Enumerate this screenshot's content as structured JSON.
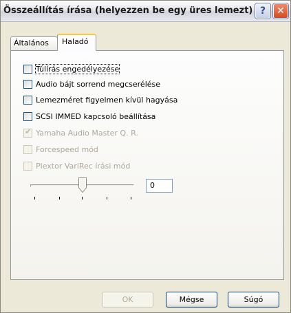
{
  "window": {
    "title": "Összeállítás írása (helyezzen be egy üres lemezt)",
    "help_glyph": "?",
    "close_glyph": "✕"
  },
  "tabs": [
    {
      "label": "Általános",
      "active": false
    },
    {
      "label": "Haladó",
      "active": true
    }
  ],
  "options": [
    {
      "label": "Túlírás engedélyezése",
      "checked": false,
      "enabled": true,
      "focused": true
    },
    {
      "label": "Audio bájt sorrend megcserélése",
      "checked": false,
      "enabled": true,
      "focused": false
    },
    {
      "label": "Lemezméret figyelmen kívül hagyása",
      "checked": false,
      "enabled": true,
      "focused": false
    },
    {
      "label": "SCSI IMMED kapcsoló beállítása",
      "checked": false,
      "enabled": true,
      "focused": false
    },
    {
      "label": "Yamaha Audio Master Q. R.",
      "checked": true,
      "enabled": false,
      "focused": false
    },
    {
      "label": "Forcespeed mód",
      "checked": false,
      "enabled": false,
      "focused": false
    },
    {
      "label": "Plextor VariRec írási mód",
      "checked": false,
      "enabled": false,
      "focused": false
    }
  ],
  "varirec": {
    "value": "0",
    "slider_level": 0.5
  },
  "buttons": {
    "ok": "OK",
    "cancel": "Mégse",
    "help": "Súgó"
  }
}
